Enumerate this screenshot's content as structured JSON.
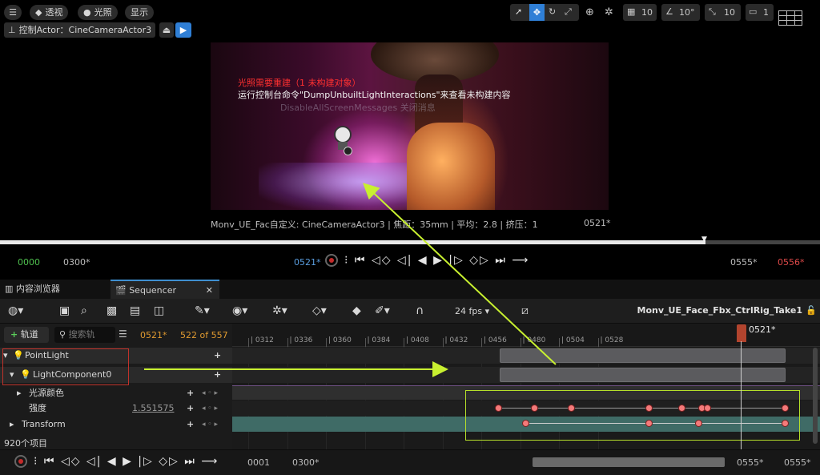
{
  "viewport_toolbar": {
    "menu_icon": "hamburger-icon",
    "perspective_label": "透视",
    "lit_label": "光照",
    "show_label": "显示",
    "pilot_label": "控制Actor：CineCameraActor3",
    "grid_value": "10",
    "rotate_value": "10°",
    "scale_value": "10",
    "camera_speed": "1"
  },
  "viewport": {
    "warning_red": "光照需要重建（1 未构建对象）",
    "warning_white": "运行控制台命令\"DumpUnbuiltLightInteractions\"来查看未构建内容",
    "ghost_text": "DisableAllScreenMessages 关闭消息",
    "caption": "Monv_UE_Fac自定义: CineCameraActor3 | 焦距：35mm | 平均：2.8 | 挤压：1",
    "caption_frame": "0521*"
  },
  "playback": {
    "start_green": "0000",
    "start_in": "0300*",
    "current": "0521*",
    "end_out": "0555*",
    "end_red": "0556*",
    "progress": 0.86
  },
  "tabs": [
    {
      "label": "内容浏览器"
    },
    {
      "label": "Sequencer"
    }
  ],
  "sequencer": {
    "fps_label": "24 fps",
    "sequence_name": "Monv_UE_Face_Fbx_CtrlRig_Take1",
    "add_track_label": "轨道",
    "search_placeholder": "搜索轨",
    "current_frame": "0521*",
    "frame_count": "522 of 557",
    "playhead_label": "0521*",
    "ruler_ticks": [
      "0312",
      "0336",
      "0360",
      "0384",
      "0408",
      "0432",
      "0456",
      "0480",
      "0504",
      "0528"
    ],
    "tracks": [
      {
        "label": "PointLight"
      },
      {
        "label": "LightComponent0"
      },
      {
        "label": "光源颜色"
      },
      {
        "label": "强度",
        "value": "1.551575"
      },
      {
        "label": "Transform"
      }
    ],
    "item_count": "920个项目"
  },
  "bottom_bar": {
    "start": "0001",
    "in": "0300*",
    "out": "0555*",
    "end": "0555*"
  },
  "colors": {
    "accent_blue": "#2f7fd6",
    "warning_red": "#ff3030",
    "playhead": "#c0523a",
    "keyframe": "#f47a7a",
    "annotation_green": "#c8f030"
  }
}
